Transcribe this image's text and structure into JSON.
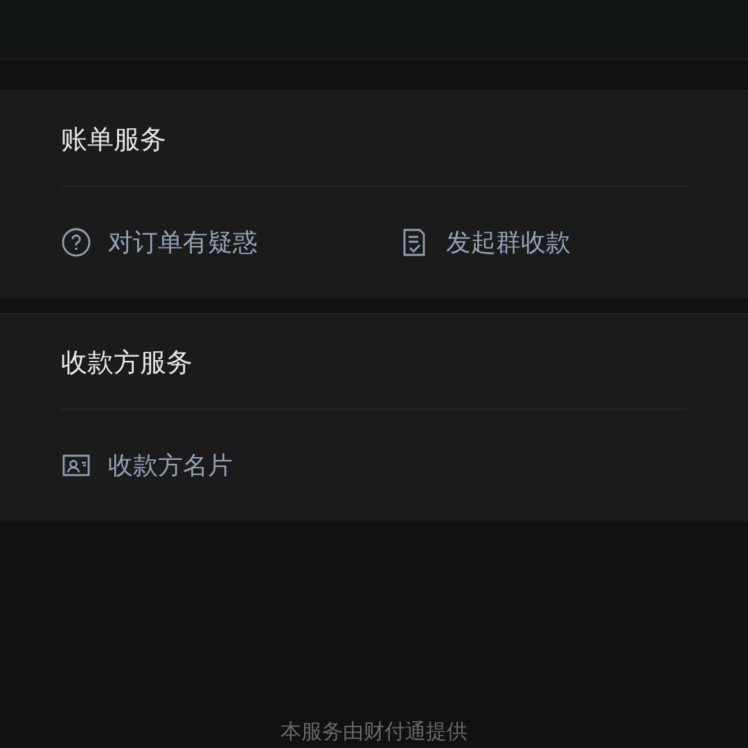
{
  "sections": [
    {
      "title": "账单服务",
      "items": [
        {
          "kind": "question",
          "label": "对订单有疑惑"
        },
        {
          "kind": "document",
          "label": "发起群收款"
        }
      ]
    },
    {
      "title": "收款方服务",
      "items": [
        {
          "kind": "card",
          "label": "收款方名片"
        }
      ]
    }
  ],
  "footer": "本服务由财付通提供"
}
